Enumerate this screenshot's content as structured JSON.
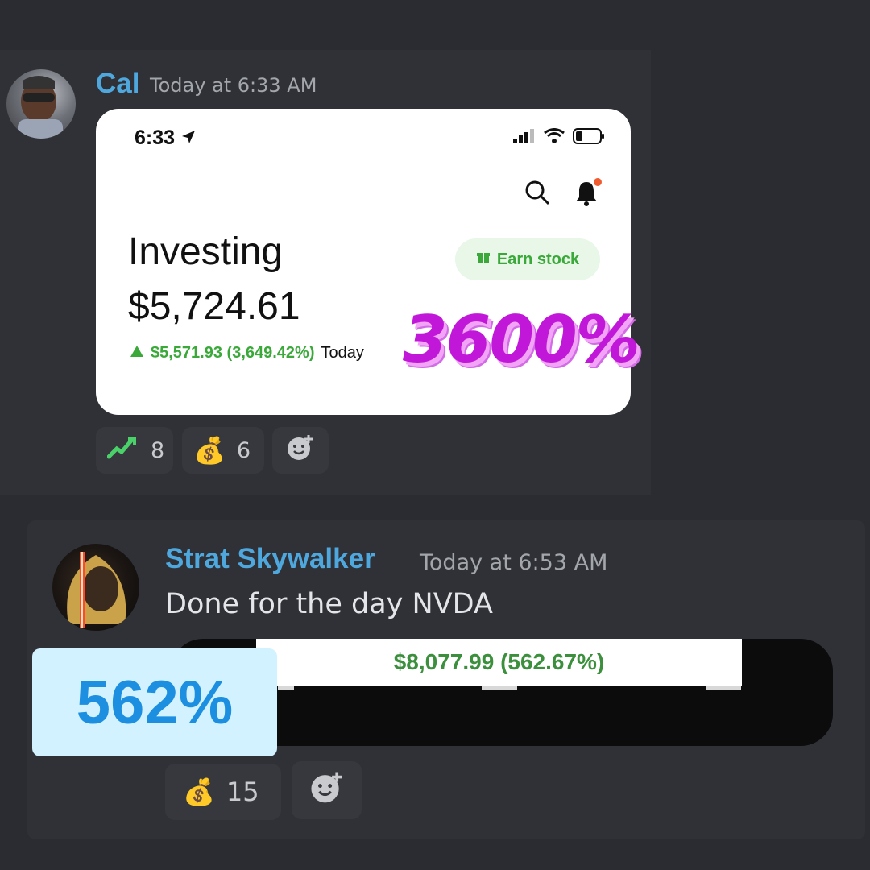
{
  "messages": [
    {
      "username": "Cal",
      "timestamp": "Today at 6:33 AM",
      "screenshot": {
        "status_time": "6:33",
        "title": "Investing",
        "value": "$5,724.61",
        "change": "$5,571.93 (3,649.42%)",
        "change_period": "Today",
        "earn_button": "Earn stock"
      },
      "overlay_label": "3600%",
      "reactions": [
        {
          "icon": "chart-up-icon",
          "count": "8"
        },
        {
          "icon": "money-bag-icon",
          "count": "6"
        }
      ]
    },
    {
      "username": "Strat Skywalker",
      "timestamp": "Today at 6:53 AM",
      "text": "Done for the day NVDA",
      "attachment_text": "$8,077.99 (562.67%)",
      "overlay_label": "562%",
      "reactions": [
        {
          "icon": "money-bag-icon",
          "count": "15"
        }
      ]
    }
  ],
  "colors": {
    "background": "#2b2c31",
    "username": "#4ea8de",
    "gain_green": "#3aa93a",
    "overlay_magenta": "#c117d9",
    "overlay_blue": "#1d8fe0"
  }
}
